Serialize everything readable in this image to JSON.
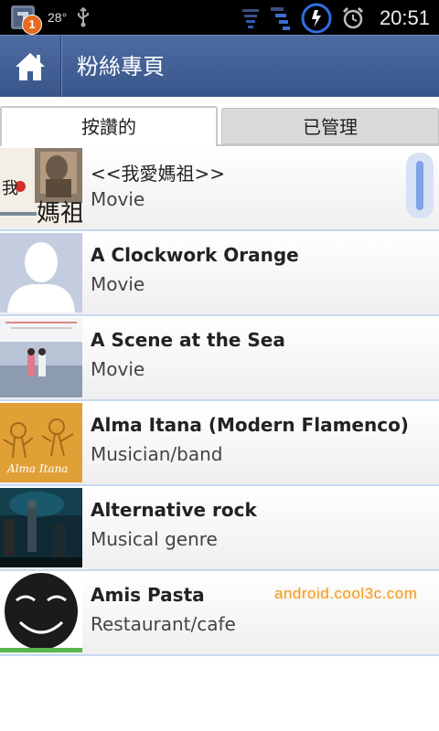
{
  "status_bar": {
    "notification_count": "1",
    "temperature": "28°",
    "time": "20:51"
  },
  "header": {
    "title": "粉絲專頁"
  },
  "tabs": [
    {
      "label": "按讚的",
      "active": true
    },
    {
      "label": "已管理",
      "active": false
    }
  ],
  "pages": [
    {
      "name": "<<我愛媽祖>>",
      "category": "Movie",
      "thumb": "poster-mazu"
    },
    {
      "name": "A Clockwork Orange",
      "category": "Movie",
      "thumb": "default-silhouette"
    },
    {
      "name": "A Scene at the Sea",
      "category": "Movie",
      "thumb": "poster-sea"
    },
    {
      "name": "Alma Itana (Modern Flamenco)",
      "category": "Musician/band",
      "thumb": "poster-flamenco"
    },
    {
      "name": "Alternative rock",
      "category": "Musical genre",
      "thumb": "photo-concert"
    },
    {
      "name": "Amis Pasta",
      "category": "Restaurant/cafe",
      "thumb": "logo-face"
    }
  ],
  "watermark": "android.cool3c.com",
  "colors": {
    "header": "#3f5c94",
    "list_divider": "#c6d9f2",
    "notification_badge": "#e56a1e",
    "watermark": "#f09a2a"
  }
}
